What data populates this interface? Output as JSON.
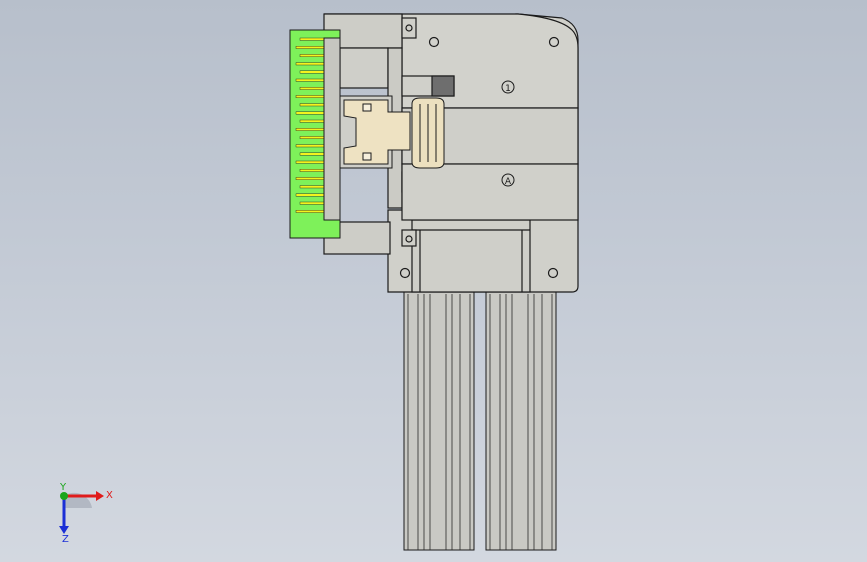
{
  "viewport": {
    "background_top": "#b7bfcb",
    "background_bottom": "#d3d8e0"
  },
  "model": {
    "part_color": "#cfcfc9",
    "edge_color": "#1b1b1b",
    "pcb_color": "#7ef15a",
    "pcb_trace_color": "#f4f21e",
    "latch_color": "#ece0bf",
    "dark_block_color": "#6f6f6f",
    "symbols": {
      "upper_marker": "1",
      "lower_marker": "A"
    }
  },
  "triad": {
    "x_label": "X",
    "y_label": "Y",
    "z_label": "Z",
    "x_color": "#e01b1b",
    "y_color": "#1ba51b",
    "z_color": "#1b2fd6"
  }
}
